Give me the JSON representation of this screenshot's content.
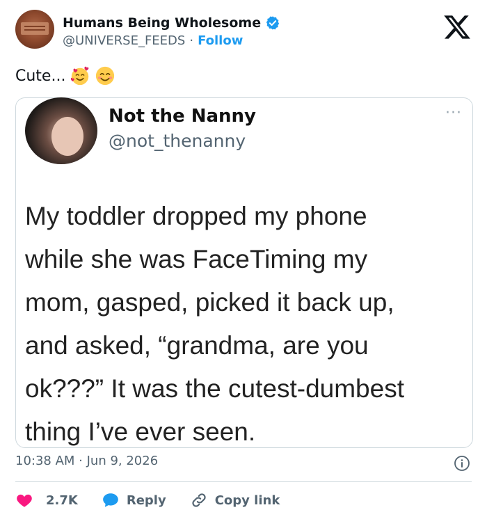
{
  "author": {
    "name": "Humans Being Wholesome",
    "handle": "@UNIVERSE_FEEDS",
    "separator": "·",
    "follow_label": "Follow"
  },
  "tweet": {
    "text": "Cute...",
    "emojis": [
      "smiling-face-with-hearts",
      "smiling-face-with-smiling-eyes"
    ]
  },
  "embedded": {
    "name": "Not the Nanny",
    "handle": "@not_thenanny",
    "more": "···",
    "lines": [
      "My toddler dropped my phone",
      "while she was FaceTiming my",
      "mom, gasped, picked it back up,",
      "and asked, “grandma, are you",
      "ok???” It was the cutest-dumbest",
      "thing I’ve ever seen."
    ]
  },
  "meta": {
    "timestamp": "10:38 AM · Jun 9, 2026"
  },
  "actions": {
    "likes": "2.7K",
    "reply_label": "Reply",
    "copy_link_label": "Copy link"
  },
  "colors": {
    "accent": "#1d9bf0",
    "heart": "#f91880",
    "text_secondary": "#536471",
    "border": "#cfd9de"
  }
}
